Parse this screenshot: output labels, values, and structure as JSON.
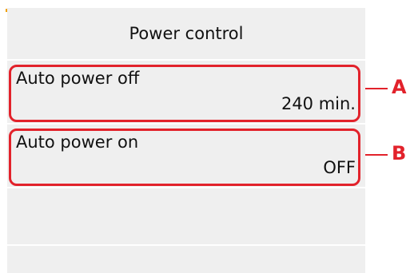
{
  "header": {
    "title": "Power control"
  },
  "items": [
    {
      "label": "Auto power off",
      "value": "240 min.",
      "callout": "A"
    },
    {
      "label": "Auto power on",
      "value": "OFF",
      "callout": "B"
    }
  ],
  "colors": {
    "highlight": "#e2222b",
    "screen_bg": "#efefef"
  }
}
